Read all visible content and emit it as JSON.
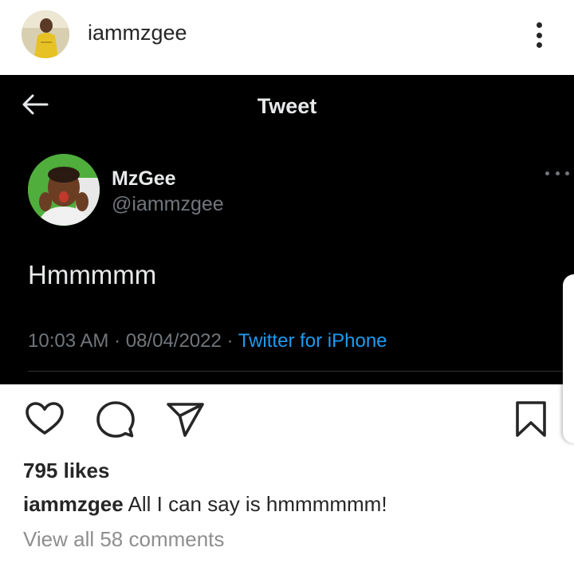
{
  "post": {
    "owner_username": "iammzgee",
    "likes_text": "795 likes",
    "caption_username": "iammzgee",
    "caption_text": "All I can say is hmmmmmm!",
    "view_comments_text": "View all 58 comments"
  },
  "tweet": {
    "screen_title": "Tweet",
    "display_name": "MzGee",
    "handle": "@iammzgee",
    "text": "Hmmmmm",
    "time": "10:03 AM",
    "separator": " · ",
    "date": "08/04/2022",
    "source": "Twitter for iPhone"
  },
  "icons": {
    "back": "arrow-left-icon",
    "more": "more-vertical-icon",
    "tweet_more": "more-horizontal-icon",
    "like": "heart-icon",
    "comment": "comment-bubble-icon",
    "share": "paper-plane-icon",
    "save": "bookmark-icon"
  },
  "colors": {
    "tweet_background": "#000000",
    "tweet_text": "#e7e9ea",
    "tweet_muted": "#71767b",
    "twitter_link": "#1d9bf0",
    "instagram_text": "#262626",
    "instagram_muted": "#8e8e8e"
  }
}
